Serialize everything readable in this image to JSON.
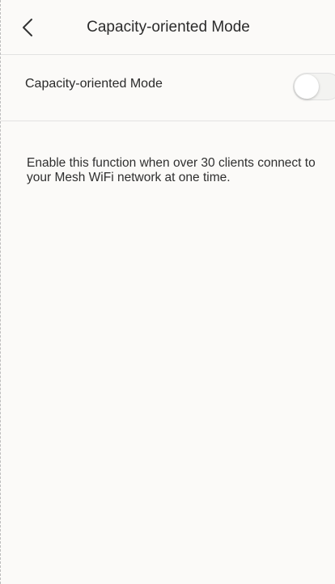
{
  "header": {
    "back_icon": "chevron-left-icon",
    "title": "Capacity-oriented Mode"
  },
  "setting": {
    "label": "Capacity-oriented Mode",
    "enabled": false
  },
  "description": {
    "text": "Enable this function when over 30 clients connect to your Mesh WiFi network at one time."
  },
  "colors": {
    "background": "#fbfaf8",
    "divider": "#e2e2e2",
    "toggle_off": "#f3f3f1"
  }
}
